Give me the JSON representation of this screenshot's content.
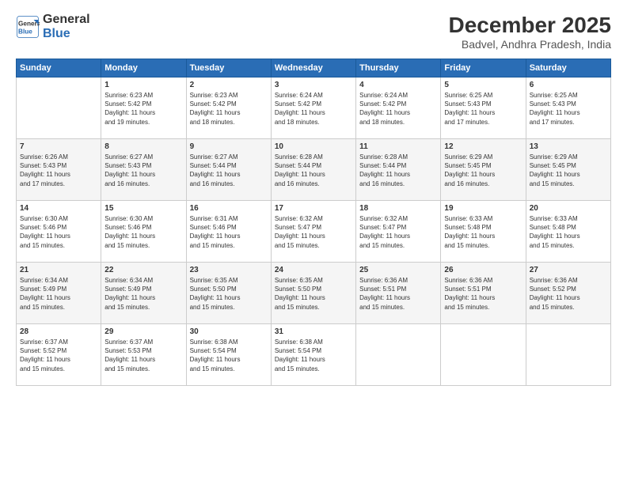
{
  "logo": {
    "line1": "General",
    "line2": "Blue"
  },
  "title": "December 2025",
  "subtitle": "Badvel, Andhra Pradesh, India",
  "days_header": [
    "Sunday",
    "Monday",
    "Tuesday",
    "Wednesday",
    "Thursday",
    "Friday",
    "Saturday"
  ],
  "weeks": [
    [
      {
        "num": "",
        "text": ""
      },
      {
        "num": "1",
        "text": "Sunrise: 6:23 AM\nSunset: 5:42 PM\nDaylight: 11 hours\nand 19 minutes."
      },
      {
        "num": "2",
        "text": "Sunrise: 6:23 AM\nSunset: 5:42 PM\nDaylight: 11 hours\nand 18 minutes."
      },
      {
        "num": "3",
        "text": "Sunrise: 6:24 AM\nSunset: 5:42 PM\nDaylight: 11 hours\nand 18 minutes."
      },
      {
        "num": "4",
        "text": "Sunrise: 6:24 AM\nSunset: 5:42 PM\nDaylight: 11 hours\nand 18 minutes."
      },
      {
        "num": "5",
        "text": "Sunrise: 6:25 AM\nSunset: 5:43 PM\nDaylight: 11 hours\nand 17 minutes."
      },
      {
        "num": "6",
        "text": "Sunrise: 6:25 AM\nSunset: 5:43 PM\nDaylight: 11 hours\nand 17 minutes."
      }
    ],
    [
      {
        "num": "7",
        "text": "Sunrise: 6:26 AM\nSunset: 5:43 PM\nDaylight: 11 hours\nand 17 minutes."
      },
      {
        "num": "8",
        "text": "Sunrise: 6:27 AM\nSunset: 5:43 PM\nDaylight: 11 hours\nand 16 minutes."
      },
      {
        "num": "9",
        "text": "Sunrise: 6:27 AM\nSunset: 5:44 PM\nDaylight: 11 hours\nand 16 minutes."
      },
      {
        "num": "10",
        "text": "Sunrise: 6:28 AM\nSunset: 5:44 PM\nDaylight: 11 hours\nand 16 minutes."
      },
      {
        "num": "11",
        "text": "Sunrise: 6:28 AM\nSunset: 5:44 PM\nDaylight: 11 hours\nand 16 minutes."
      },
      {
        "num": "12",
        "text": "Sunrise: 6:29 AM\nSunset: 5:45 PM\nDaylight: 11 hours\nand 16 minutes."
      },
      {
        "num": "13",
        "text": "Sunrise: 6:29 AM\nSunset: 5:45 PM\nDaylight: 11 hours\nand 15 minutes."
      }
    ],
    [
      {
        "num": "14",
        "text": "Sunrise: 6:30 AM\nSunset: 5:46 PM\nDaylight: 11 hours\nand 15 minutes."
      },
      {
        "num": "15",
        "text": "Sunrise: 6:30 AM\nSunset: 5:46 PM\nDaylight: 11 hours\nand 15 minutes."
      },
      {
        "num": "16",
        "text": "Sunrise: 6:31 AM\nSunset: 5:46 PM\nDaylight: 11 hours\nand 15 minutes."
      },
      {
        "num": "17",
        "text": "Sunrise: 6:32 AM\nSunset: 5:47 PM\nDaylight: 11 hours\nand 15 minutes."
      },
      {
        "num": "18",
        "text": "Sunrise: 6:32 AM\nSunset: 5:47 PM\nDaylight: 11 hours\nand 15 minutes."
      },
      {
        "num": "19",
        "text": "Sunrise: 6:33 AM\nSunset: 5:48 PM\nDaylight: 11 hours\nand 15 minutes."
      },
      {
        "num": "20",
        "text": "Sunrise: 6:33 AM\nSunset: 5:48 PM\nDaylight: 11 hours\nand 15 minutes."
      }
    ],
    [
      {
        "num": "21",
        "text": "Sunrise: 6:34 AM\nSunset: 5:49 PM\nDaylight: 11 hours\nand 15 minutes."
      },
      {
        "num": "22",
        "text": "Sunrise: 6:34 AM\nSunset: 5:49 PM\nDaylight: 11 hours\nand 15 minutes."
      },
      {
        "num": "23",
        "text": "Sunrise: 6:35 AM\nSunset: 5:50 PM\nDaylight: 11 hours\nand 15 minutes."
      },
      {
        "num": "24",
        "text": "Sunrise: 6:35 AM\nSunset: 5:50 PM\nDaylight: 11 hours\nand 15 minutes."
      },
      {
        "num": "25",
        "text": "Sunrise: 6:36 AM\nSunset: 5:51 PM\nDaylight: 11 hours\nand 15 minutes."
      },
      {
        "num": "26",
        "text": "Sunrise: 6:36 AM\nSunset: 5:51 PM\nDaylight: 11 hours\nand 15 minutes."
      },
      {
        "num": "27",
        "text": "Sunrise: 6:36 AM\nSunset: 5:52 PM\nDaylight: 11 hours\nand 15 minutes."
      }
    ],
    [
      {
        "num": "28",
        "text": "Sunrise: 6:37 AM\nSunset: 5:52 PM\nDaylight: 11 hours\nand 15 minutes."
      },
      {
        "num": "29",
        "text": "Sunrise: 6:37 AM\nSunset: 5:53 PM\nDaylight: 11 hours\nand 15 minutes."
      },
      {
        "num": "30",
        "text": "Sunrise: 6:38 AM\nSunset: 5:54 PM\nDaylight: 11 hours\nand 15 minutes."
      },
      {
        "num": "31",
        "text": "Sunrise: 6:38 AM\nSunset: 5:54 PM\nDaylight: 11 hours\nand 15 minutes."
      },
      {
        "num": "",
        "text": ""
      },
      {
        "num": "",
        "text": ""
      },
      {
        "num": "",
        "text": ""
      }
    ]
  ]
}
